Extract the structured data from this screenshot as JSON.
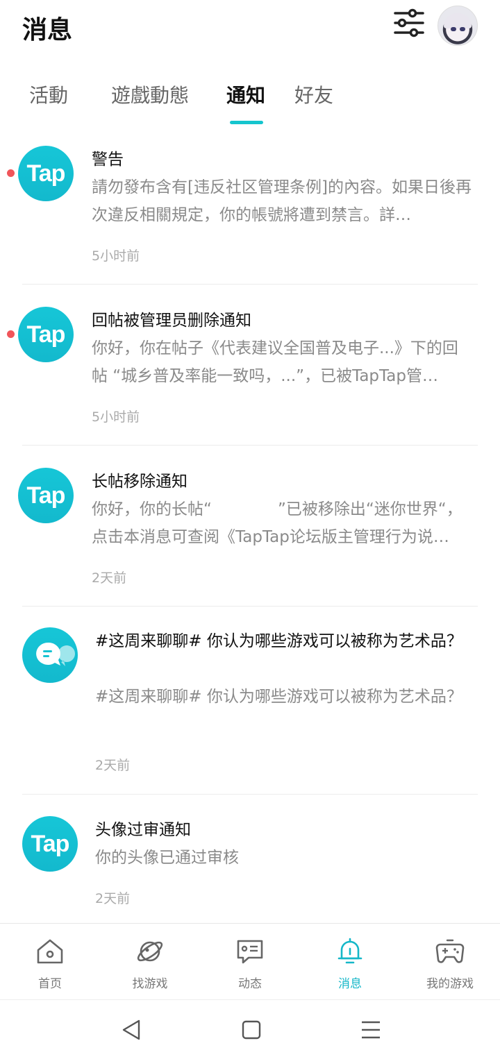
{
  "header": {
    "title": "消息"
  },
  "tabs": [
    {
      "label": "活動"
    },
    {
      "label": "遊戲動態"
    },
    {
      "label": "通知"
    },
    {
      "label": "好友"
    }
  ],
  "notifications": [
    {
      "title": "警告",
      "body": "請勿發布含有[违反社区管理条例]的內容。如果日後再次違反相關規定，你的帳號將遭到禁言。詳…",
      "time": "5小时前",
      "logo": "Tap"
    },
    {
      "title": "回帖被管理员删除通知",
      "body": "你好，你在帖子《代表建议全国普及电子...》下的回帖 “城乡普及率能一致吗，...”，已被TapTap管…",
      "time": "5小时前",
      "logo": "Tap"
    },
    {
      "title": "长帖移除通知",
      "body": "你好，你的长帖“             ”已被移除出“迷你世界“，点击本消息可查阅《TapTap论坛版主管理行为说…",
      "time": "2天前",
      "logo": "Tap"
    },
    {
      "title": "#这周来聊聊# 你认为哪些游戏可以被称为艺术品？",
      "body": "#这周来聊聊# 你认为哪些游戏可以被称为艺术品？",
      "time": "2天前"
    },
    {
      "title": "头像过审通知",
      "body": "你的头像已通过审核",
      "time": "2天前",
      "logo": "Tap"
    }
  ],
  "bottom_nav": [
    {
      "label": "首页",
      "icon": "home-icon"
    },
    {
      "label": "找游戏",
      "icon": "planet-icon"
    },
    {
      "label": "动态",
      "icon": "chat-card-icon"
    },
    {
      "label": "消息",
      "icon": "bell-icon"
    },
    {
      "label": "我的游戏",
      "icon": "gamepad-icon"
    }
  ],
  "colors": {
    "accent": "#15c5ce",
    "unread": "#f0555a"
  }
}
